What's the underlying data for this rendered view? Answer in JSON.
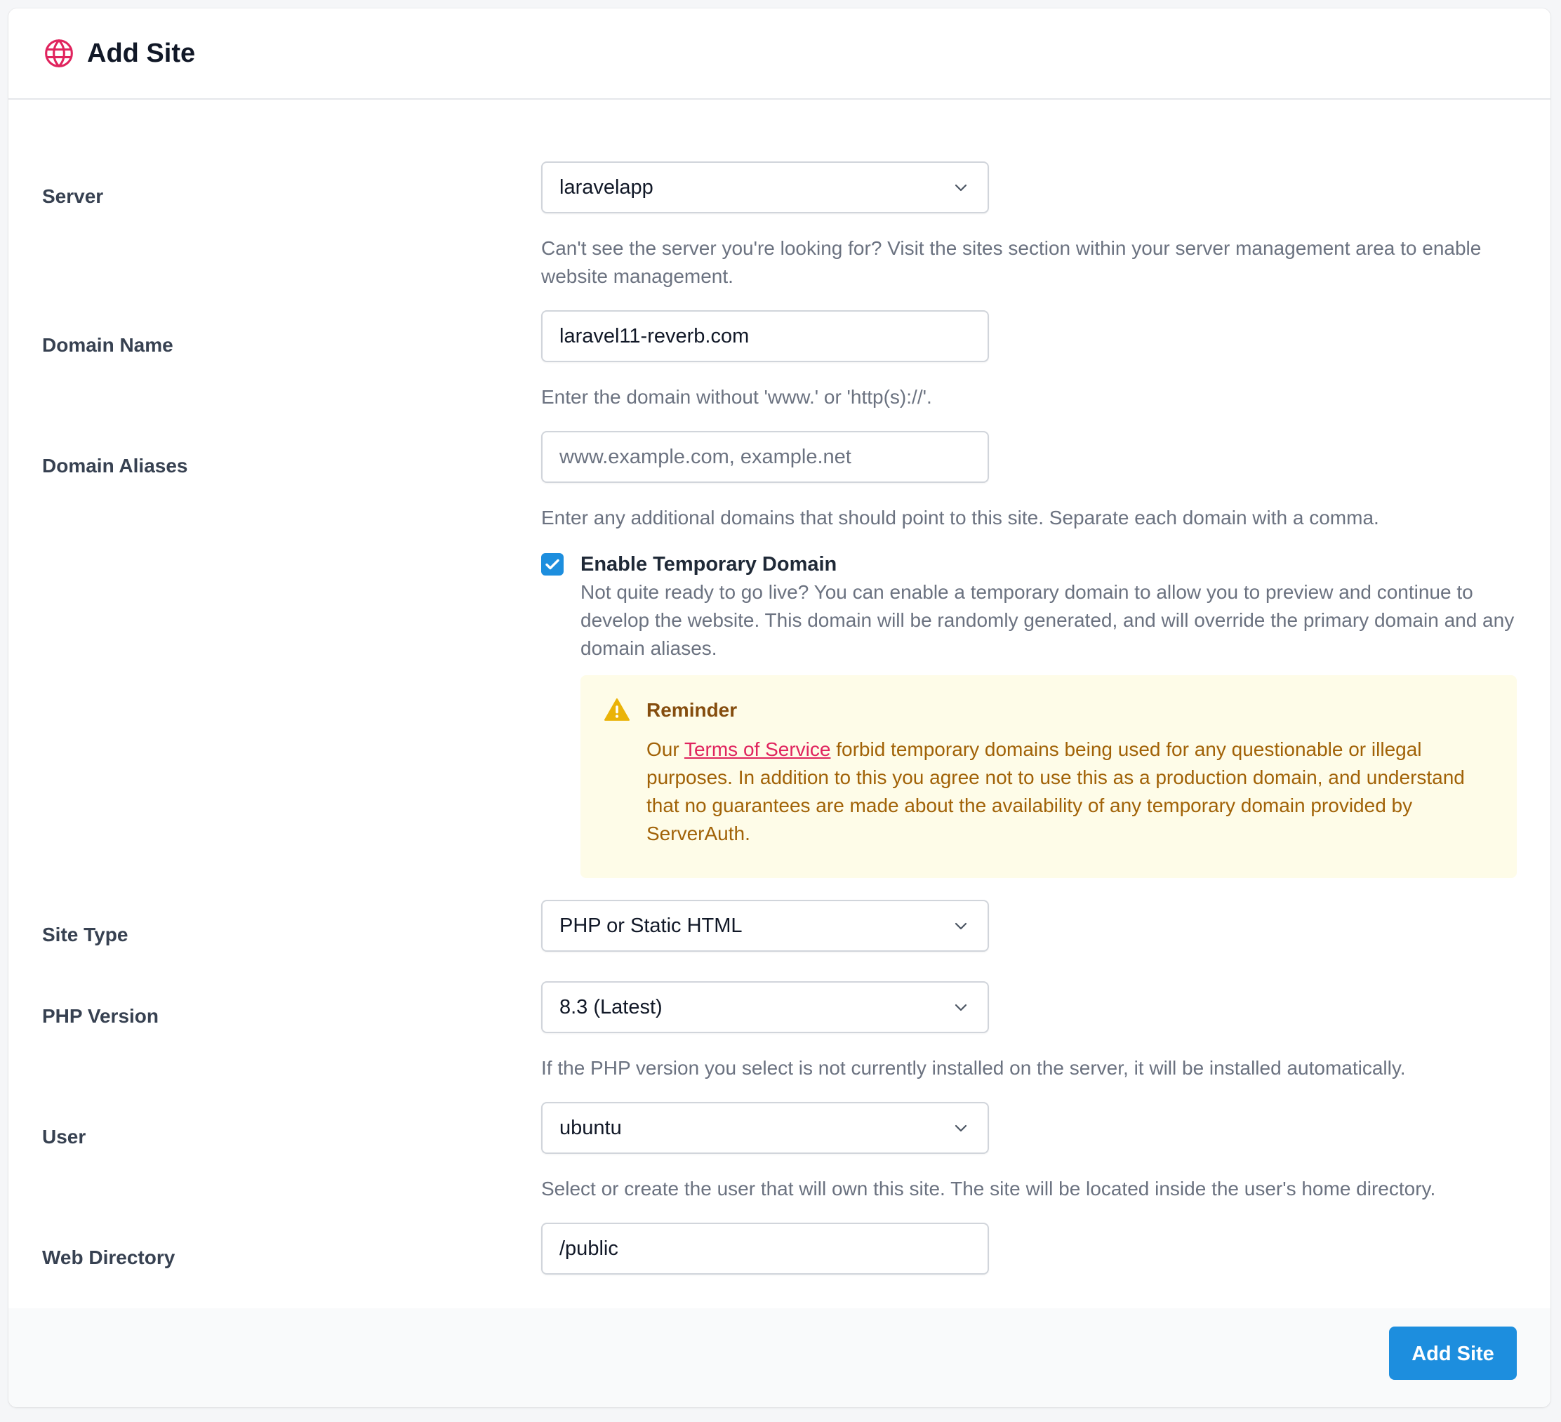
{
  "header": {
    "title": "Add Site",
    "icon": "globe-icon"
  },
  "colors": {
    "accent": "#1d8ede",
    "brand_icon": "#e0245e",
    "warning_bg": "#fefce8",
    "warning_text": "#a16207"
  },
  "form": {
    "server": {
      "label": "Server",
      "value": "laravelapp",
      "help": "Can't see the server you're looking for? Visit the sites section within your server management area to enable website management."
    },
    "domain_name": {
      "label": "Domain Name",
      "value": "laravel11-reverb.com",
      "help": "Enter the domain without 'www.' or 'http(s)://'."
    },
    "domain_aliases": {
      "label": "Domain Aliases",
      "placeholder": "www.example.com, example.net",
      "help": "Enter any additional domains that should point to this site. Separate each domain with a comma."
    },
    "temporary_domain": {
      "label": "Enable Temporary Domain",
      "checked": true,
      "description": "Not quite ready to go live? You can enable a temporary domain to allow you to preview and continue to develop the website. This domain will be randomly generated, and will override the primary domain and any domain aliases."
    },
    "reminder": {
      "title": "Reminder",
      "prefix": "Our ",
      "link": "Terms of Service",
      "suffix": " forbid temporary domains being used for any questionable or illegal purposes. In addition to this you agree not to use this as a production domain, and understand that no guarantees are made about the availability of any temporary domain provided by ServerAuth."
    },
    "site_type": {
      "label": "Site Type",
      "value": "PHP or Static HTML"
    },
    "php_version": {
      "label": "PHP Version",
      "value": "8.3 (Latest)",
      "help": "If the PHP version you select is not currently installed on the server, it will be installed automatically."
    },
    "user": {
      "label": "User",
      "value": "ubuntu",
      "help": "Select or create the user that will own this site. The site will be located inside the user's home directory."
    },
    "web_directory": {
      "label": "Web Directory",
      "value": "/public"
    }
  },
  "footer": {
    "submit_label": "Add Site"
  }
}
